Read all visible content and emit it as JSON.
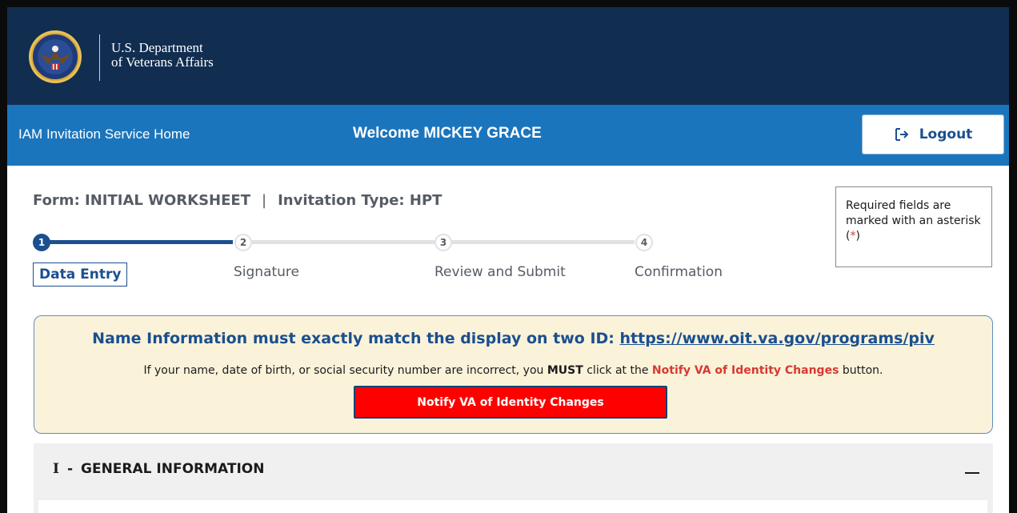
{
  "header": {
    "brand_line1": "U.S. Department",
    "brand_line2": "of Veterans Affairs"
  },
  "navbar": {
    "home_link": "IAM Invitation Service Home",
    "welcome": "Welcome MICKEY GRACE",
    "logout_label": "Logout"
  },
  "form": {
    "title": "Form: INITIAL WORKSHEET",
    "separator": "|",
    "invitation_type": "Invitation Type: HPT"
  },
  "required_note": {
    "text": "Required fields are marked with an asterisk (",
    "asterisk": "*",
    "close": ")"
  },
  "stepper": {
    "current_step": 1,
    "steps": [
      {
        "number": "1",
        "label": "Data Entry"
      },
      {
        "number": "2",
        "label": "Signature"
      },
      {
        "number": "3",
        "label": "Review and Submit"
      },
      {
        "number": "4",
        "label": "Confirmation"
      }
    ]
  },
  "alert": {
    "heading_prefix": "Name Information must exactly match the display on two ID: ",
    "heading_link": "https://www.oit.va.gov/programs/piv",
    "body_prefix": "If your name, date of birth, or social security number are incorrect, you ",
    "body_must": "MUST",
    "body_middle": " click at the ",
    "body_button_ref": "Notify VA of Identity Changes",
    "body_suffix": " button.",
    "button_label": "Notify VA of Identity Changes"
  },
  "accordion": {
    "numeral": "I",
    "dash": "-",
    "title": "GENERAL INFORMATION"
  },
  "colors": {
    "header_bg": "#112e51",
    "navbar_bg": "#1b75bc",
    "primary": "#1b4f8f",
    "alert_bg": "#faf3d9",
    "notify_button": "#ff0000",
    "required_asterisk": "#d83933"
  }
}
